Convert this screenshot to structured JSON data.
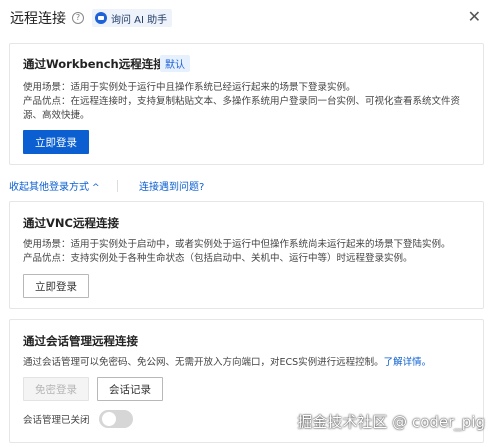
{
  "header": {
    "title": "远程连接",
    "help_icon": "?",
    "ai_button_label": "询问 AI 助手",
    "close_icon": "✕"
  },
  "workbench": {
    "title": "通过Workbench远程连接",
    "badge": "默认",
    "usage": "使用场景：适用于实例处于运行中且操作系统已经运行起来的场景下登录实例。",
    "advantage_line1": "产品优点：在远程连接时，支持复制粘贴文本、多操作系统用户登录同一台实例、可视化查看系统文件资",
    "advantage_line2": "源、高效快捷。",
    "login_button": "立即登录"
  },
  "links": {
    "collapse_other": "收起其他登录方式",
    "collapse_chevron": "^",
    "trouble": "连接遇到问题?"
  },
  "vnc": {
    "title": "通过VNC远程连接",
    "usage": "使用场景：适用于实例处于启动中，或者实例处于运行中但操作系统尚未运行起来的场景下登陆实例。",
    "advantage": "产品优点：支持实例处于各种生命状态（包括启动中、关机中、运行中等）时远程登录实例。",
    "login_button": "立即登录"
  },
  "session": {
    "title": "通过会话管理远程连接",
    "description": "通过会话管理可以免密码、免公网、无需开放入方向端口，对ECS实例进行远程控制。",
    "learn_more": "了解详情。",
    "passwordless_button": "免密登录",
    "records_button": "会话记录",
    "toggle_label": "会话管理已关闭",
    "toggle_on": false
  },
  "watermark": "掘金技术社区 @ coder_pig"
}
